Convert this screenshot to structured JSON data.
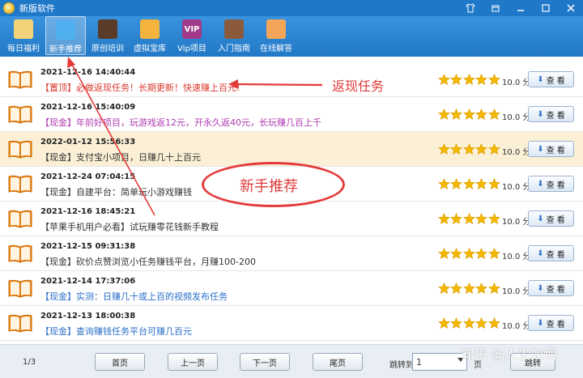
{
  "window": {
    "title": "新版软件",
    "controls": [
      "shirt-icon",
      "restore-icon",
      "minimize-icon",
      "maximize-icon",
      "close-icon"
    ]
  },
  "toolbar": {
    "items": [
      {
        "label": "每日福利",
        "icon": "lucky-cat-icon",
        "color": "#f2d37a",
        "active": false
      },
      {
        "label": "新手推荐",
        "icon": "monitor-icon",
        "color": "#4fb0ef",
        "active": true
      },
      {
        "label": "原创培训",
        "icon": "blackboard-icon",
        "color": "#5a3b2a",
        "active": false
      },
      {
        "label": "虚拟宝库",
        "icon": "treasure-icon",
        "color": "#f3b33d",
        "active": false
      },
      {
        "label": "Vip项目",
        "icon": "vip-icon",
        "color": "#a23a8a",
        "icon_text": "VIP",
        "active": false
      },
      {
        "label": "入门指南",
        "icon": "guide-book-icon",
        "color": "#8b5a3c",
        "active": false
      },
      {
        "label": "在线解答",
        "icon": "support-person-icon",
        "color": "#f3a65a",
        "active": false
      }
    ]
  },
  "rows": [
    {
      "date": "2021-12-16 14:40:44",
      "tag": "【置顶】",
      "text": "必做返现任务！长期更新！快速赚上百元!",
      "color": "#d93a2e",
      "score": "10.0 分",
      "view": "查 看"
    },
    {
      "date": "2021-12-16 15:40:09",
      "tag": "【现金】",
      "text": "年前好项目，玩游戏返12元，开永久返40元，长玩赚几百上千",
      "color": "#b03ab0",
      "score": "10.0 分",
      "view": "查 看"
    },
    {
      "date": "2022-01-12 15:56:33",
      "tag": "【现金】",
      "text": "支付宝小项目，日赚几十上百元",
      "color": "#333333",
      "score": "10.0 分",
      "view": "查 看",
      "selected": true
    },
    {
      "date": "2021-12-24 07:04:15",
      "tag": "【现金】",
      "text": "自建平台：简单玩小游戏赚钱",
      "color": "#333333",
      "score": "10.0 分",
      "view": "查 看"
    },
    {
      "date": "2021-12-16 18:45:21",
      "tag": "【苹果手机用户必看】",
      "text": "试玩赚零花钱新手教程",
      "color": "#333333",
      "score": "10.0 分",
      "view": "查 看"
    },
    {
      "date": "2021-12-15 09:31:38",
      "tag": "【现金】",
      "text": "砍价点赞浏览小任务赚钱平台，月赚100-200",
      "color": "#333333",
      "score": "10.0 分",
      "view": "查 看"
    },
    {
      "date": "2021-12-14 17:37:06",
      "tag": "【现金】",
      "text": "实测：日赚几十或上百的视频发布任务",
      "color": "#2a6fc9",
      "score": "10.0 分",
      "view": "查 看"
    },
    {
      "date": "2021-12-13 18:00:38",
      "tag": "【现金】",
      "text": "查询赚钱任务平台可赚几百元",
      "color": "#2a6fc9",
      "score": "10.0 分",
      "view": "查 看"
    }
  ],
  "annotations": {
    "cashback_label": "返现任务",
    "newbie_label": "新手推荐",
    "color": "#e53b3b"
  },
  "footer": {
    "page_count": "1/3",
    "first": "首页",
    "prev": "上一页",
    "next": "下一页",
    "last": "尾页",
    "jump_label": "跳转到",
    "jump_value": "1",
    "page_unit": "页",
    "go": "跳转"
  },
  "watermark": "知乎 @人生如烟",
  "star_color": "#f5b800"
}
